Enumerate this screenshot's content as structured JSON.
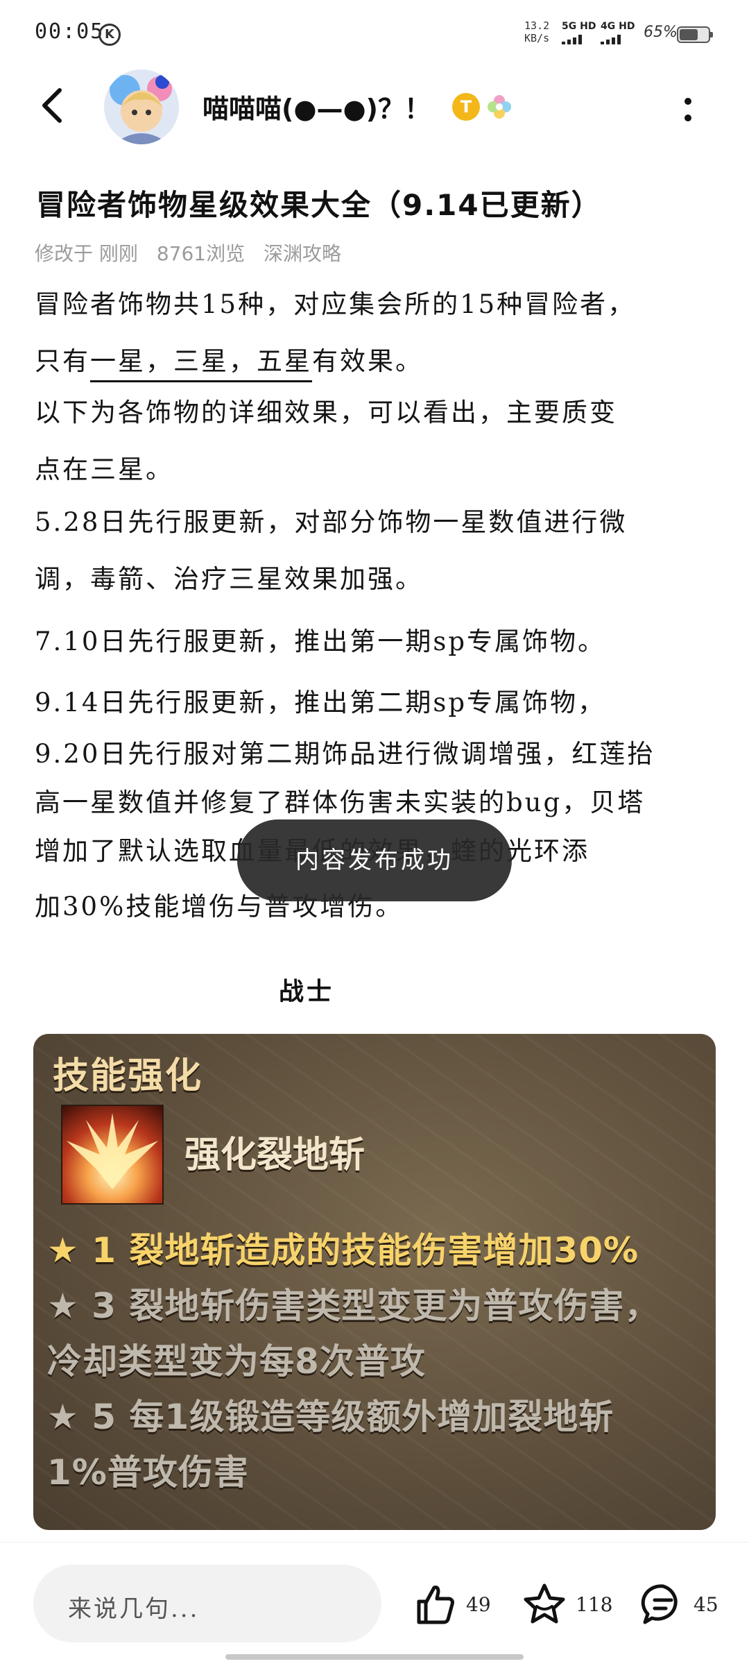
{
  "status_bar": {
    "time": "00:05",
    "k_badge": "K",
    "net_speed_value": "13.2",
    "net_speed_unit": "KB/s",
    "signal_1": "5G HD",
    "signal_2": "4G HD",
    "battery_percent": "65%",
    "battery_level": 0.65
  },
  "header": {
    "username": "喵喵喵(●—●)？！",
    "badge_text": "T"
  },
  "article": {
    "title": "冒险者饰物星级效果大全（9.14已更新）",
    "meta": {
      "modified": "修改于 刚刚",
      "views": "8761浏览",
      "category": "深渊攻略"
    },
    "lines": {
      "l1": "冒险者饰物共15种，对应集会所的15种冒险者，",
      "l2a": "只有",
      "l2b": "一星，三星，五星",
      "l2c": "有效果。",
      "l3": "以下为各饰物的详细效果，可以看出，主要质变",
      "l4": "点在三星。",
      "l5": "5.28日先行服更新，对部分饰物一星数值进行微",
      "l6": "调，毒箭、治疗三星效果加强。",
      "l7": "7.10日先行服更新，推出第一期sp专属饰物。",
      "l8": "9.14日先行服更新，推出第二期sp专属饰物，",
      "l9": "9.20日先行服对第二期饰品进行微调增强，红莲抬",
      "l10": "高一星数值并修复了群体伤害未实装的bug，贝塔",
      "l11": "增加了默认选取血量最低的效果，蝰的光环添",
      "l12": "加30%技能增伤与普攻增伤。"
    },
    "section_heading": "战士"
  },
  "toast": "内容发布成功",
  "skill_card": {
    "header": "技能强化",
    "skill_name": "强化裂地斩",
    "line1": "★ 1 裂地斩造成的技能伤害增加30%",
    "line2": "★ 3 裂地斩伤害类型变更为普攻伤害，",
    "line3": "冷却类型变为每8次普攻",
    "line4": "★ 5 每1级锻造等级额外增加裂地斩",
    "line5": "1%普攻伤害"
  },
  "bottom_bar": {
    "comment_placeholder": "来说几句...",
    "likes": "49",
    "favorites": "118",
    "comments": "45"
  }
}
